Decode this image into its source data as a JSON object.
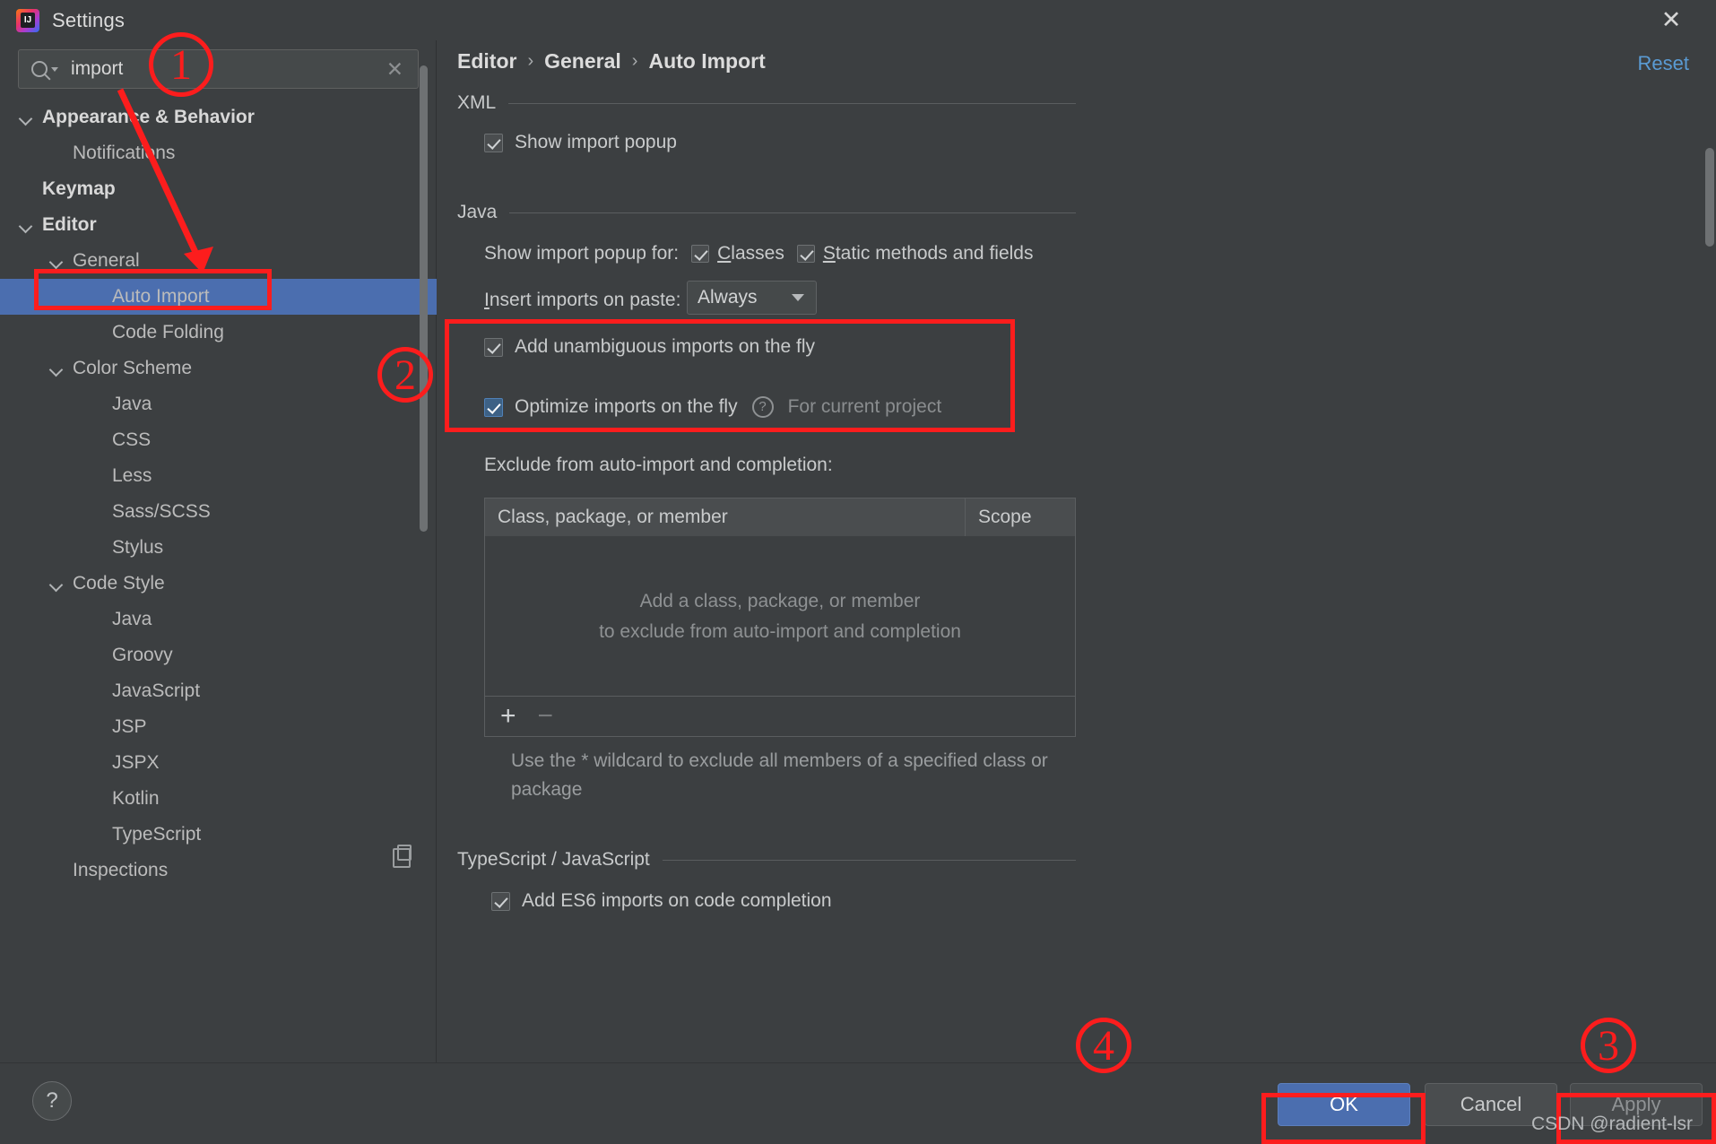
{
  "window": {
    "title": "Settings",
    "app_icon": "intellij-idea-icon",
    "close_label": "✕"
  },
  "search": {
    "value": "import",
    "placeholder": "Search settings",
    "clear_label": "✕",
    "icon": "search-icon"
  },
  "sidebar": {
    "items": [
      {
        "label": "Appearance & Behavior",
        "indent": 0,
        "expandable": true,
        "bold": true,
        "selected": false
      },
      {
        "label": "Notifications",
        "indent": 1,
        "expandable": false,
        "bold": false,
        "selected": false
      },
      {
        "label": "Keymap",
        "indent": 0,
        "expandable": false,
        "bold": true,
        "selected": false
      },
      {
        "label": "Editor",
        "indent": 0,
        "expandable": true,
        "bold": true,
        "selected": false
      },
      {
        "label": "General",
        "indent": 1,
        "expandable": true,
        "bold": false,
        "selected": false
      },
      {
        "label": "Auto Import",
        "indent": 2,
        "expandable": false,
        "bold": false,
        "selected": true
      },
      {
        "label": "Code Folding",
        "indent": 2,
        "expandable": false,
        "bold": false,
        "selected": false
      },
      {
        "label": "Color Scheme",
        "indent": 1,
        "expandable": true,
        "bold": false,
        "selected": false
      },
      {
        "label": "Java",
        "indent": 2,
        "expandable": false,
        "bold": false,
        "selected": false
      },
      {
        "label": "CSS",
        "indent": 2,
        "expandable": false,
        "bold": false,
        "selected": false
      },
      {
        "label": "Less",
        "indent": 2,
        "expandable": false,
        "bold": false,
        "selected": false
      },
      {
        "label": "Sass/SCSS",
        "indent": 2,
        "expandable": false,
        "bold": false,
        "selected": false
      },
      {
        "label": "Stylus",
        "indent": 2,
        "expandable": false,
        "bold": false,
        "selected": false
      },
      {
        "label": "Code Style",
        "indent": 1,
        "expandable": true,
        "bold": false,
        "selected": false
      },
      {
        "label": "Java",
        "indent": 2,
        "expandable": false,
        "bold": false,
        "selected": false
      },
      {
        "label": "Groovy",
        "indent": 2,
        "expandable": false,
        "bold": false,
        "selected": false
      },
      {
        "label": "JavaScript",
        "indent": 2,
        "expandable": false,
        "bold": false,
        "selected": false
      },
      {
        "label": "JSP",
        "indent": 2,
        "expandable": false,
        "bold": false,
        "selected": false
      },
      {
        "label": "JSPX",
        "indent": 2,
        "expandable": false,
        "bold": false,
        "selected": false
      },
      {
        "label": "Kotlin",
        "indent": 2,
        "expandable": false,
        "bold": false,
        "selected": false
      },
      {
        "label": "TypeScript",
        "indent": 2,
        "expandable": false,
        "bold": false,
        "selected": false
      },
      {
        "label": "Inspections",
        "indent": 1,
        "expandable": false,
        "bold": false,
        "selected": false
      }
    ]
  },
  "breadcrumb": {
    "level1": "Editor",
    "level2": "General",
    "level3": "Auto Import",
    "separator": "›"
  },
  "reset": {
    "label": "Reset"
  },
  "sections": {
    "xml": {
      "title": "XML",
      "show_import_popup": {
        "label": "Show import popup",
        "checked": true
      }
    },
    "java": {
      "title": "Java",
      "show_import_popup_for_label": "Show import popup for:",
      "classes": {
        "label": "Classes",
        "mnemonic": "C",
        "rest": "lasses",
        "checked": true
      },
      "static_methods": {
        "label": "Static methods and fields",
        "mnemonic": "S",
        "rest": "tatic methods and fields",
        "checked": true
      },
      "insert_imports_label": "Insert imports on paste:",
      "insert_imports_mnemonic": "I",
      "insert_imports_rest": "nsert imports on paste:",
      "insert_imports_value": "Always",
      "add_unambiguous": {
        "label": "Add unambiguous imports on the fly",
        "checked": true
      },
      "optimize_imports": {
        "label": "Optimize imports on the fly",
        "checked": true,
        "highlighted": true
      },
      "optimize_help_icon": "question-mark-icon",
      "optimize_scope_note": "For current project",
      "exclude_label": "Exclude from auto-import and completion:",
      "table": {
        "columns": [
          "Class, package, or member",
          "Scope"
        ],
        "rows": [],
        "empty_line1": "Add a class, package, or member",
        "empty_line2": "to exclude from auto-import and completion",
        "add_button": "+",
        "remove_button": "−"
      },
      "wildcard_note": "Use the * wildcard to exclude all members of a specified class or package"
    },
    "ts_js": {
      "title": "TypeScript / JavaScript",
      "add_es6": {
        "label": "Add ES6 imports on code completion",
        "checked": true
      }
    }
  },
  "footer": {
    "help_label": "?",
    "ok_label": "OK",
    "cancel_label": "Cancel",
    "apply_label": "Apply"
  },
  "annotations": {
    "marker1": "1",
    "marker2": "2",
    "marker3": "3",
    "marker4": "4",
    "accent_color": "#fc1d1d"
  },
  "watermark": {
    "text": "CSDN @radient-lsr"
  }
}
